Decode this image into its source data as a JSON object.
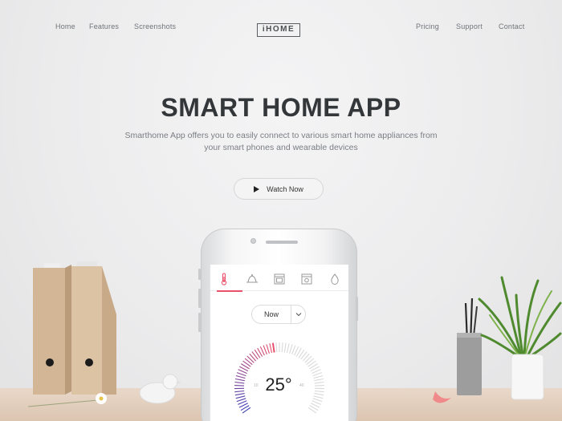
{
  "nav": {
    "left": [
      "Home",
      "Features",
      "Screenshots"
    ],
    "logo": "iHOME",
    "right": [
      "Pricing",
      "Support",
      "Contact"
    ]
  },
  "hero": {
    "title": "SMART HOME APP",
    "subtitle_line1": "Smarthome App offers you to easily connect to various smart home appliances from",
    "subtitle_line2": "your smart phones and wearable devices",
    "cta_label": "Watch Now"
  },
  "app": {
    "tabs": [
      "thermometer-icon",
      "bell-icon",
      "oven-icon",
      "stove-icon",
      "water-drop-icon"
    ],
    "active_tab": 0,
    "mode_select": "Now",
    "temperature": "25°",
    "dial_min": "10",
    "dial_max": "40",
    "accent": "#e8506b",
    "dial_gradient_start": "#3a3fb8",
    "dial_gradient_end": "#e8506b"
  }
}
